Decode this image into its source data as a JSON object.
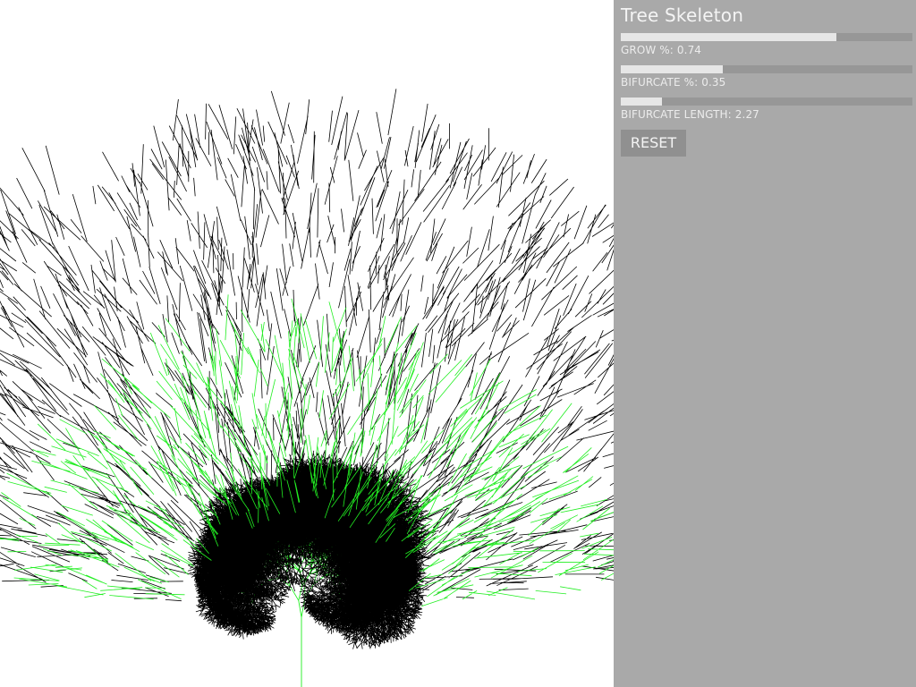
{
  "panel": {
    "title": "Tree Skeleton",
    "sliders": [
      {
        "id": "grow",
        "label": "GROW %:",
        "value": 0.74,
        "display": "0.74",
        "fraction": 0.74
      },
      {
        "id": "bifurcate",
        "label": "BIFURCATE %:",
        "value": 0.35,
        "display": "0.35",
        "fraction": 0.35
      },
      {
        "id": "bifurcate_length",
        "label": "BIFURCATE LENGTH:",
        "value": 2.27,
        "display": "2.27",
        "fraction": 0.14
      }
    ],
    "reset_label": "RESET"
  },
  "colors": {
    "panel_bg": "#a9a9a9",
    "track": "#979797",
    "fill": "#e6e6e6",
    "button_bg": "#909090",
    "branch_young": "#22ee22",
    "branch_old": "#000000",
    "canvas_bg": "#ffffff"
  }
}
